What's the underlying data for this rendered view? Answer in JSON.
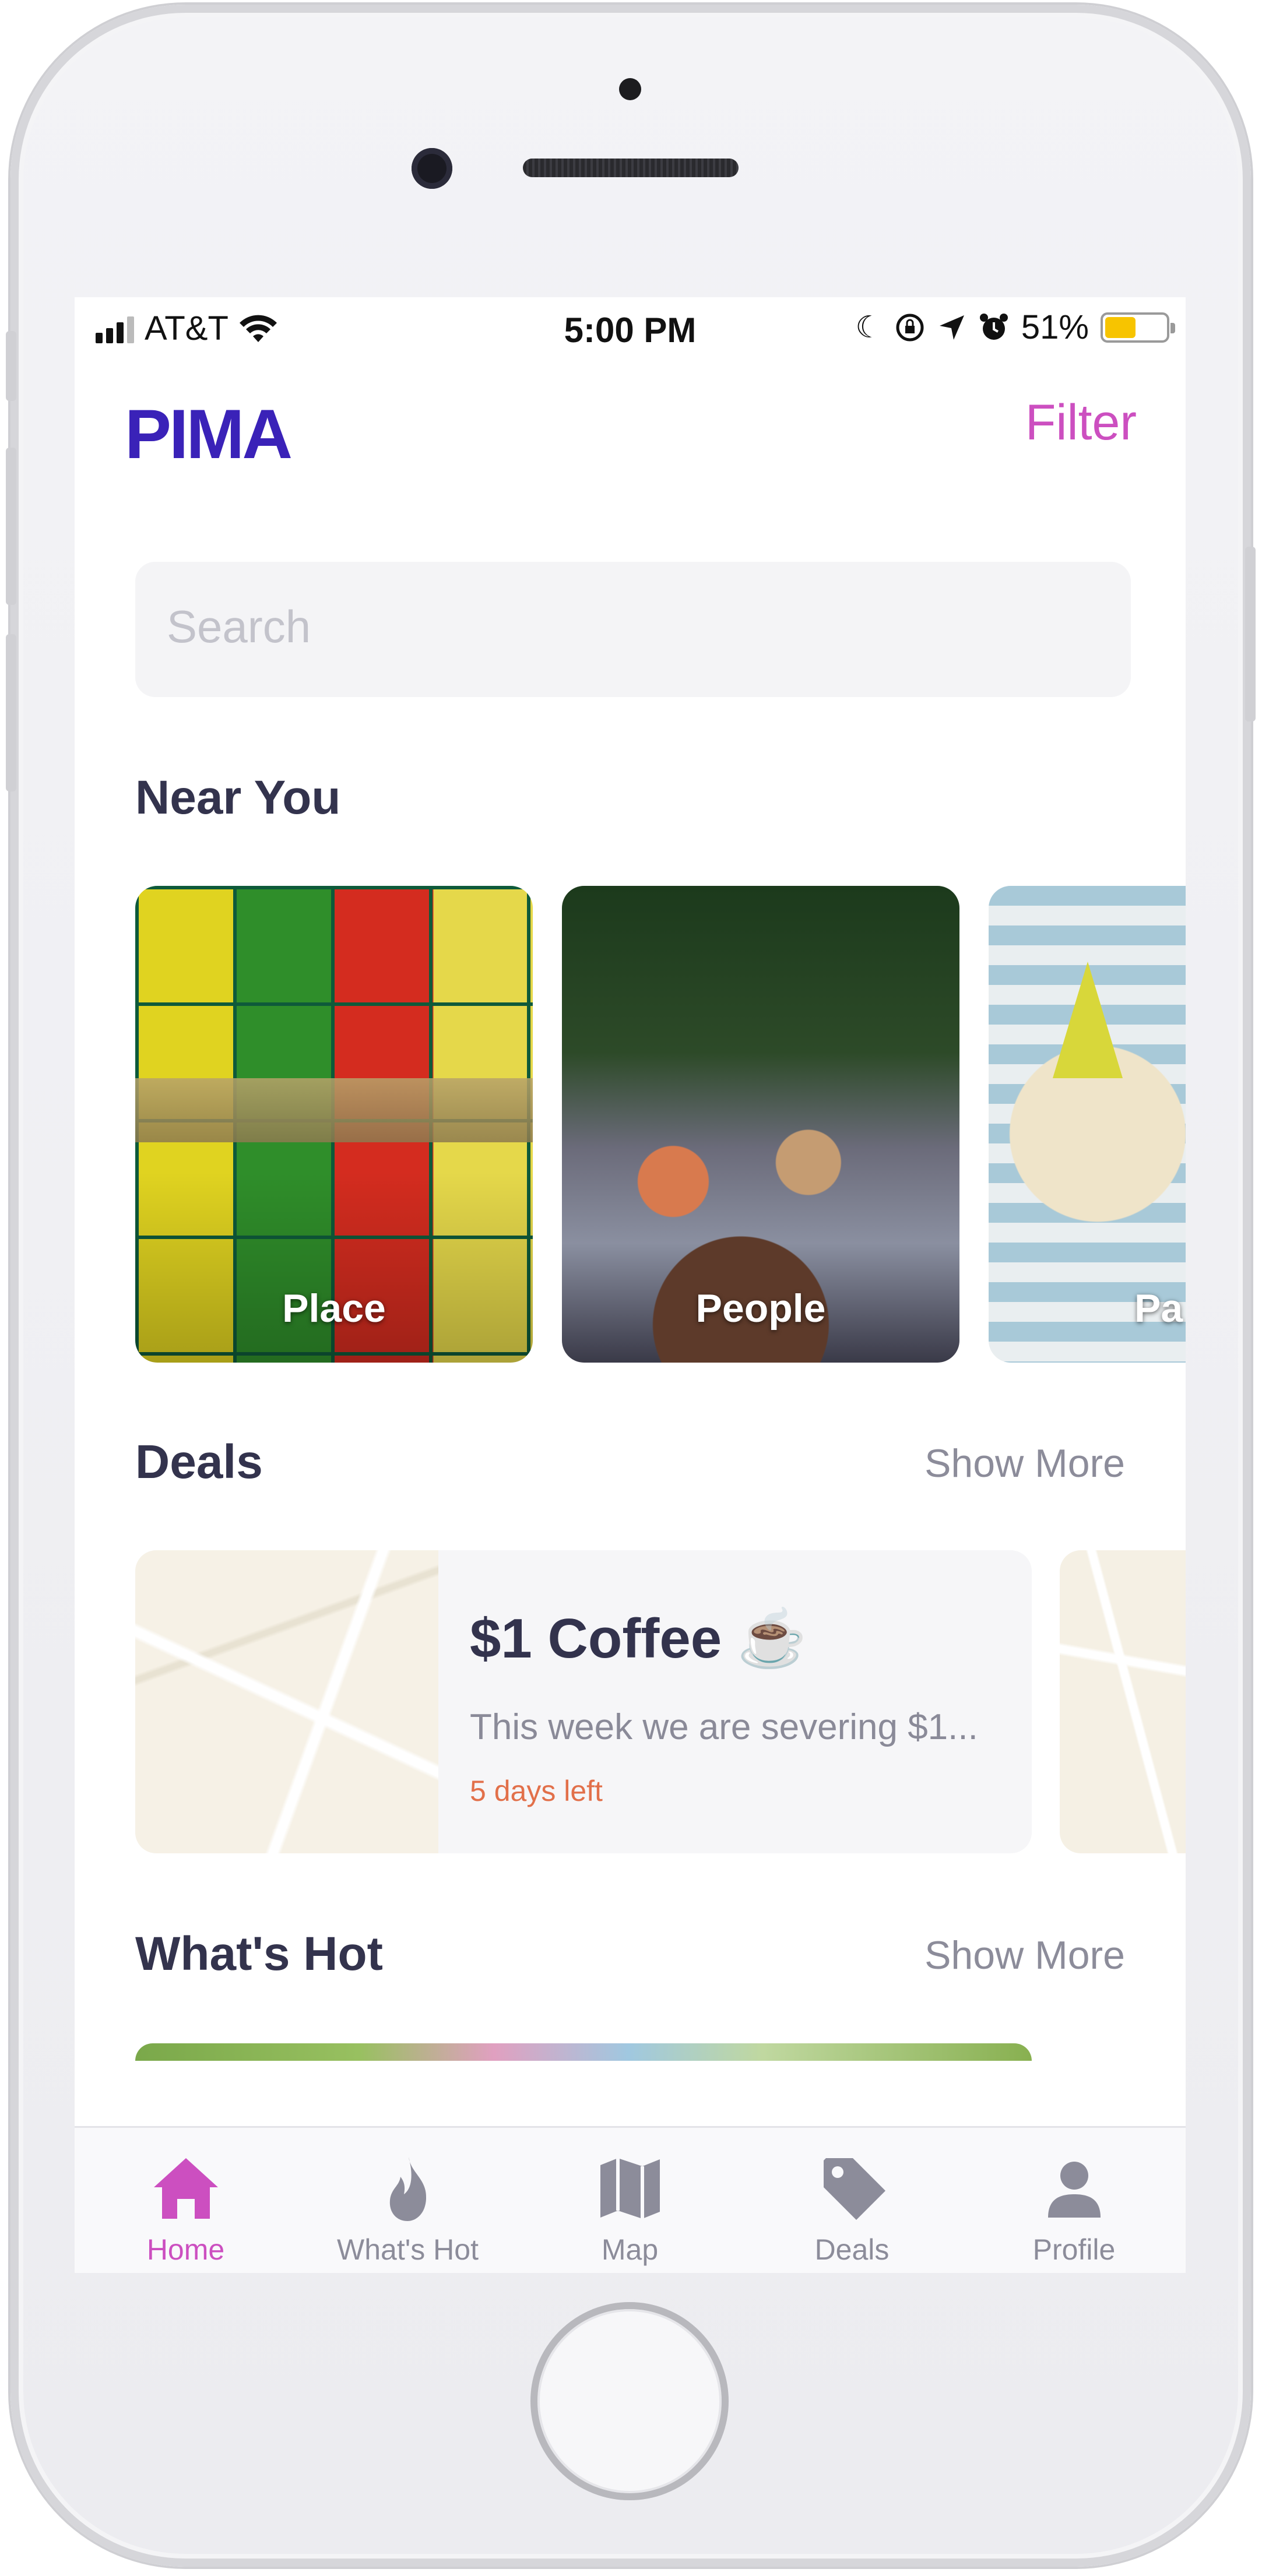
{
  "status_bar": {
    "carrier": "AT&T",
    "time": "5:00 PM",
    "battery_percent": "51%",
    "battery_level": 0.51,
    "icons": [
      "signal-icon",
      "wifi-icon",
      "moon-icon",
      "rotation-lock-icon",
      "location-icon",
      "alarm-icon",
      "battery-icon"
    ]
  },
  "header": {
    "logo": "PIMA",
    "filter_label": "Filter"
  },
  "search": {
    "placeholder": "Search"
  },
  "near_you": {
    "title": "Near You",
    "cards": [
      {
        "label": "Place"
      },
      {
        "label": "People"
      },
      {
        "label": "Pa"
      }
    ]
  },
  "deals": {
    "title": "Deals",
    "show_more": "Show More",
    "items": [
      {
        "title": "$1 Coffee ☕",
        "description": "This week we are severing $1...",
        "days_left": "5 days left"
      }
    ]
  },
  "whats_hot": {
    "title": "What's Hot",
    "show_more": "Show More"
  },
  "tab_bar": {
    "active": "Home",
    "accent_color": "#cc4fc0",
    "inactive_color": "#8c8c9a",
    "tabs": [
      {
        "label": "Home",
        "icon": "home-icon"
      },
      {
        "label": "What's Hot",
        "icon": "flame-icon"
      },
      {
        "label": "Map",
        "icon": "map-icon"
      },
      {
        "label": "Deals",
        "icon": "tag-icon"
      },
      {
        "label": "Profile",
        "icon": "person-icon"
      }
    ]
  },
  "colors": {
    "brand": "#3a22b8",
    "filter": "#cc4fc0",
    "heading": "#33334d",
    "deal_days": "#e2704a"
  }
}
